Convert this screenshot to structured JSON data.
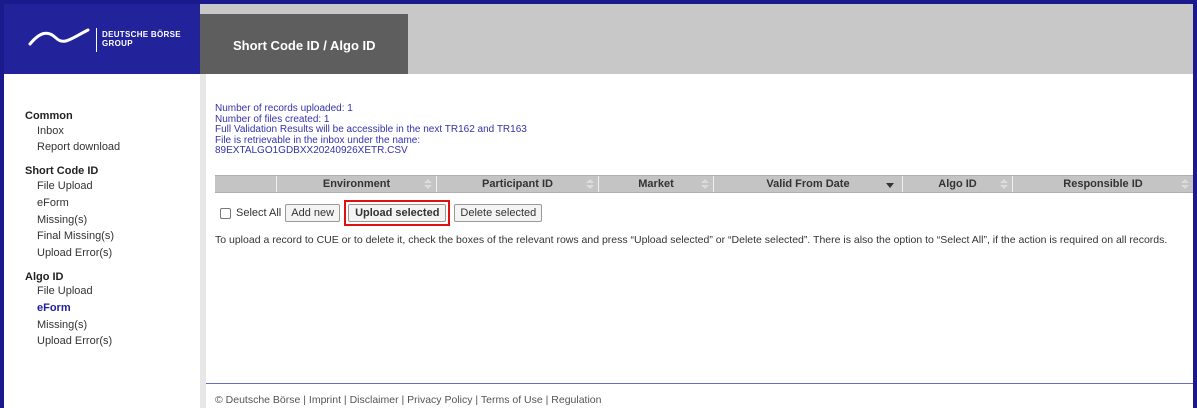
{
  "brand": {
    "line1": "DEUTSCHE BÖRSE",
    "line2": "GROUP",
    "colors": {
      "brand_blue": "#22229a",
      "header_gray": "#c8c8c8",
      "tab_gray": "#5e5e5e",
      "highlight_red": "#e01010"
    }
  },
  "header": {
    "tab_title": "Short Code ID / Algo ID"
  },
  "sidebar": {
    "common": {
      "heading": "Common",
      "items": [
        "Inbox",
        "Report download"
      ]
    },
    "short_code": {
      "heading": "Short Code ID",
      "items": [
        "File Upload",
        "eForm",
        "Missing(s)",
        "Final Missing(s)",
        "Upload Error(s)"
      ]
    },
    "algo": {
      "heading": "Algo ID",
      "items": [
        "File Upload",
        "eForm",
        "Missing(s)",
        "Upload Error(s)"
      ],
      "active_item": "eForm"
    }
  },
  "messages": [
    "Number of records uploaded: 1",
    "Number of files created: 1",
    "Full Validation Results will be accessible in the next TR162 and TR163",
    "File is retrievable in the inbox under the name:",
    "89EXTALGO1GDBXX20240926XETR.CSV"
  ],
  "grid": {
    "columns": [
      "",
      "Environment",
      "Participant ID",
      "Market",
      "Valid From Date",
      "Algo ID",
      "Responsible ID"
    ],
    "sorted_column": "Valid From Date",
    "rows": []
  },
  "actions": {
    "select_all_label": "Select All",
    "select_all_checked": false,
    "add_new": "Add new",
    "upload_selected": "Upload selected",
    "delete_selected": "Delete selected"
  },
  "hint": "To upload a record to CUE or to delete it, check the boxes of the relevant rows and press “Upload selected” or “Delete selected”. There is also the option to “Select All”, if the action is required on all records.",
  "footer": "© Deutsche Börse | Imprint | Disclaimer | Privacy Policy | Terms of Use | Regulation"
}
